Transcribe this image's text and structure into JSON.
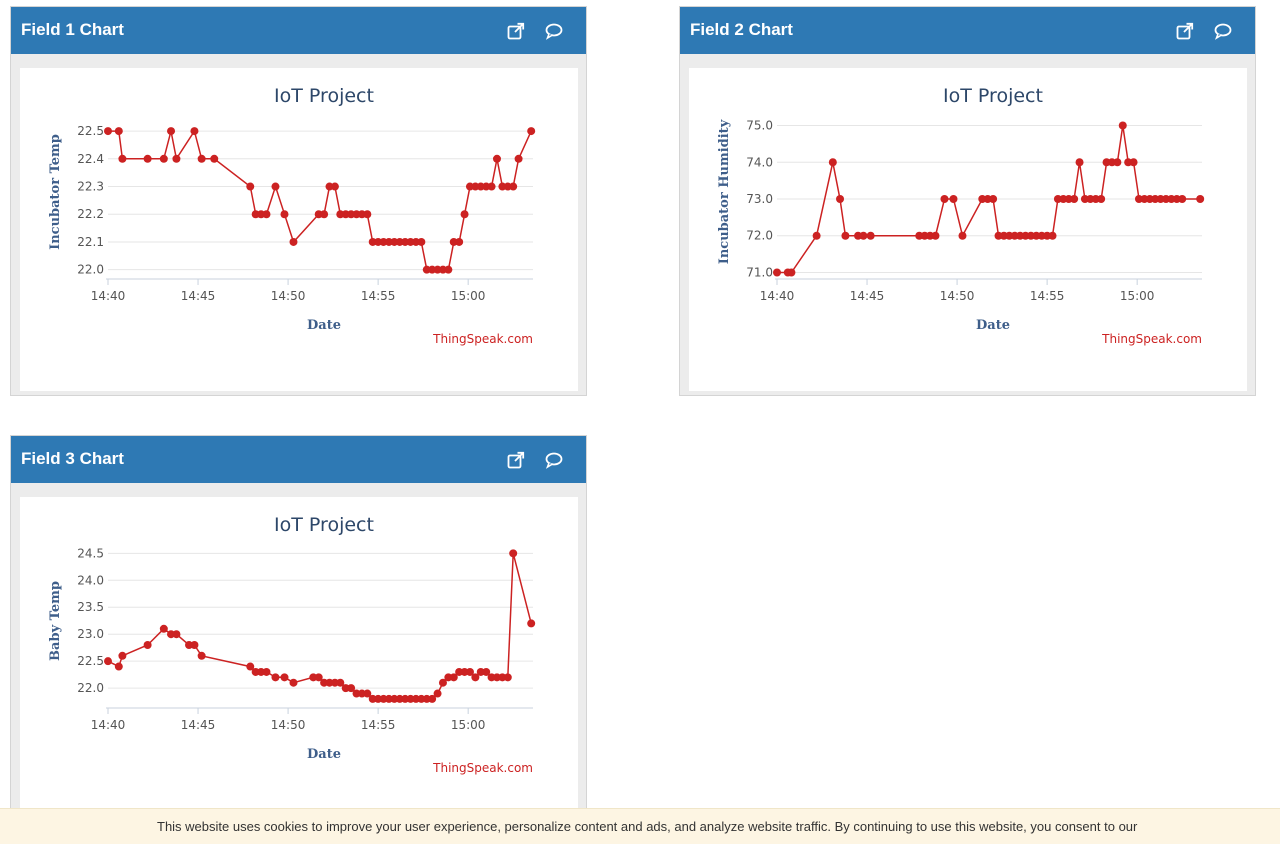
{
  "cookie_bar": {
    "text": "This website uses cookies to improve your user experience, personalize content and ads, and analyze website traffic. By continuing to use this website, you consent to our"
  },
  "icons": {
    "external": "external-link-icon",
    "comment": "comment-icon"
  },
  "colors": {
    "header": "#2e79b4",
    "series": "#cc2222",
    "grid": "#e6e6e6",
    "credit": "#cc2222"
  },
  "panels": [
    {
      "header": "Field 1 Chart",
      "chart_data": {
        "type": "line",
        "title": "IoT Project",
        "xlabel": "Date",
        "ylabel": "Incubator Temp",
        "credit": "ThingSpeak.com",
        "x_unit": "minutes after 14:00",
        "xlim": [
          40.0,
          63.6
        ],
        "ylim": [
          21.97,
          22.54
        ],
        "yticks": [
          22.0,
          22.1,
          22.2,
          22.3,
          22.4,
          22.5
        ],
        "ytick_labels": [
          "22.0",
          "22.1",
          "22.2",
          "22.3",
          "22.4",
          "22.5"
        ],
        "xticks": [
          40,
          45,
          50,
          55,
          60
        ],
        "xtick_labels": [
          "14:40",
          "14:45",
          "14:50",
          "14:55",
          "15:00"
        ],
        "x": [
          40.0,
          40.6,
          40.8,
          42.2,
          43.1,
          43.5,
          43.8,
          44.8,
          45.2,
          45.9,
          47.9,
          48.2,
          48.5,
          48.8,
          49.3,
          49.8,
          50.3,
          51.7,
          52.0,
          52.3,
          52.6,
          52.9,
          53.2,
          53.5,
          53.8,
          54.1,
          54.4,
          54.7,
          55.0,
          55.3,
          55.6,
          55.9,
          56.2,
          56.5,
          56.8,
          57.1,
          57.4,
          57.7,
          58.0,
          58.3,
          58.6,
          58.9,
          59.2,
          59.5,
          59.8,
          60.1,
          60.4,
          60.7,
          61.0,
          61.3,
          61.6,
          61.9,
          62.2,
          62.5,
          62.8,
          63.5
        ],
        "y": [
          22.5,
          22.5,
          22.4,
          22.4,
          22.4,
          22.5,
          22.4,
          22.5,
          22.4,
          22.4,
          22.3,
          22.2,
          22.2,
          22.2,
          22.3,
          22.2,
          22.1,
          22.2,
          22.2,
          22.3,
          22.3,
          22.2,
          22.2,
          22.2,
          22.2,
          22.2,
          22.2,
          22.1,
          22.1,
          22.1,
          22.1,
          22.1,
          22.1,
          22.1,
          22.1,
          22.1,
          22.1,
          22.0,
          22.0,
          22.0,
          22.0,
          22.0,
          22.1,
          22.1,
          22.2,
          22.3,
          22.3,
          22.3,
          22.3,
          22.3,
          22.4,
          22.3,
          22.3,
          22.3,
          22.4,
          22.5
        ]
      }
    },
    {
      "header": "Field 2 Chart",
      "chart_data": {
        "type": "line",
        "title": "IoT Project",
        "xlabel": "Date",
        "ylabel": "Incubator Humidity",
        "credit": "ThingSpeak.com",
        "x_unit": "minutes after 14:00",
        "xlim": [
          40.0,
          63.6
        ],
        "ylim": [
          70.85,
          75.15
        ],
        "yticks": [
          71.0,
          72.0,
          73.0,
          74.0,
          75.0
        ],
        "ytick_labels": [
          "71.0",
          "72.0",
          "73.0",
          "74.0",
          "75.0"
        ],
        "xticks": [
          40,
          45,
          50,
          55,
          60
        ],
        "xtick_labels": [
          "14:40",
          "14:45",
          "14:50",
          "14:55",
          "15:00"
        ],
        "x": [
          40.0,
          40.6,
          40.8,
          42.2,
          43.1,
          43.5,
          43.8,
          44.5,
          44.8,
          45.2,
          47.9,
          48.2,
          48.5,
          48.8,
          49.3,
          49.8,
          50.3,
          51.4,
          51.7,
          52.0,
          52.3,
          52.6,
          52.9,
          53.2,
          53.5,
          53.8,
          54.1,
          54.4,
          54.7,
          55.0,
          55.3,
          55.6,
          55.9,
          56.2,
          56.5,
          56.8,
          57.1,
          57.4,
          57.7,
          58.0,
          58.3,
          58.6,
          58.9,
          59.2,
          59.5,
          59.8,
          60.1,
          60.4,
          60.7,
          61.0,
          61.3,
          61.6,
          61.9,
          62.2,
          62.5,
          63.5
        ],
        "y": [
          71.0,
          71.0,
          71.0,
          72.0,
          74.0,
          73.0,
          72.0,
          72.0,
          72.0,
          72.0,
          72.0,
          72.0,
          72.0,
          72.0,
          73.0,
          73.0,
          72.0,
          73.0,
          73.0,
          73.0,
          72.0,
          72.0,
          72.0,
          72.0,
          72.0,
          72.0,
          72.0,
          72.0,
          72.0,
          72.0,
          72.0,
          73.0,
          73.0,
          73.0,
          73.0,
          74.0,
          73.0,
          73.0,
          73.0,
          73.0,
          74.0,
          74.0,
          74.0,
          75.0,
          74.0,
          74.0,
          73.0,
          73.0,
          73.0,
          73.0,
          73.0,
          73.0,
          73.0,
          73.0,
          73.0,
          73.0
        ]
      }
    },
    {
      "header": "Field 3 Chart",
      "chart_data": {
        "type": "line",
        "title": "IoT Project",
        "xlabel": "Date",
        "ylabel": "Baby Temp",
        "credit": "ThingSpeak.com",
        "x_unit": "minutes after 14:00",
        "xlim": [
          40.0,
          63.6
        ],
        "ylim": [
          21.65,
          24.58
        ],
        "yticks": [
          22.0,
          22.5,
          23.0,
          23.5,
          24.0,
          24.5
        ],
        "ytick_labels": [
          "22.0",
          "22.5",
          "23.0",
          "23.5",
          "24.0",
          "24.5"
        ],
        "xticks": [
          40,
          45,
          50,
          55,
          60
        ],
        "xtick_labels": [
          "14:40",
          "14:45",
          "14:50",
          "14:55",
          "15:00"
        ],
        "x": [
          40.0,
          40.6,
          40.8,
          42.2,
          43.1,
          43.5,
          43.8,
          44.5,
          44.8,
          45.2,
          47.9,
          48.2,
          48.5,
          48.8,
          49.3,
          49.8,
          50.3,
          51.4,
          51.7,
          52.0,
          52.3,
          52.6,
          52.9,
          53.2,
          53.5,
          53.8,
          54.1,
          54.4,
          54.7,
          55.0,
          55.3,
          55.6,
          55.9,
          56.2,
          56.5,
          56.8,
          57.1,
          57.4,
          57.7,
          58.0,
          58.3,
          58.6,
          58.9,
          59.2,
          59.5,
          59.8,
          60.1,
          60.4,
          60.7,
          61.0,
          61.3,
          61.6,
          61.9,
          62.2,
          62.5,
          63.5
        ],
        "y": [
          22.5,
          22.4,
          22.6,
          22.8,
          23.1,
          23.0,
          23.0,
          22.8,
          22.8,
          22.6,
          22.4,
          22.3,
          22.3,
          22.3,
          22.2,
          22.2,
          22.1,
          22.2,
          22.2,
          22.1,
          22.1,
          22.1,
          22.1,
          22.0,
          22.0,
          21.9,
          21.9,
          21.9,
          21.8,
          21.8,
          21.8,
          21.8,
          21.8,
          21.8,
          21.8,
          21.8,
          21.8,
          21.8,
          21.8,
          21.8,
          21.9,
          22.1,
          22.2,
          22.2,
          22.3,
          22.3,
          22.3,
          22.2,
          22.3,
          22.3,
          22.2,
          22.2,
          22.2,
          22.2,
          24.5,
          23.2
        ]
      }
    }
  ]
}
